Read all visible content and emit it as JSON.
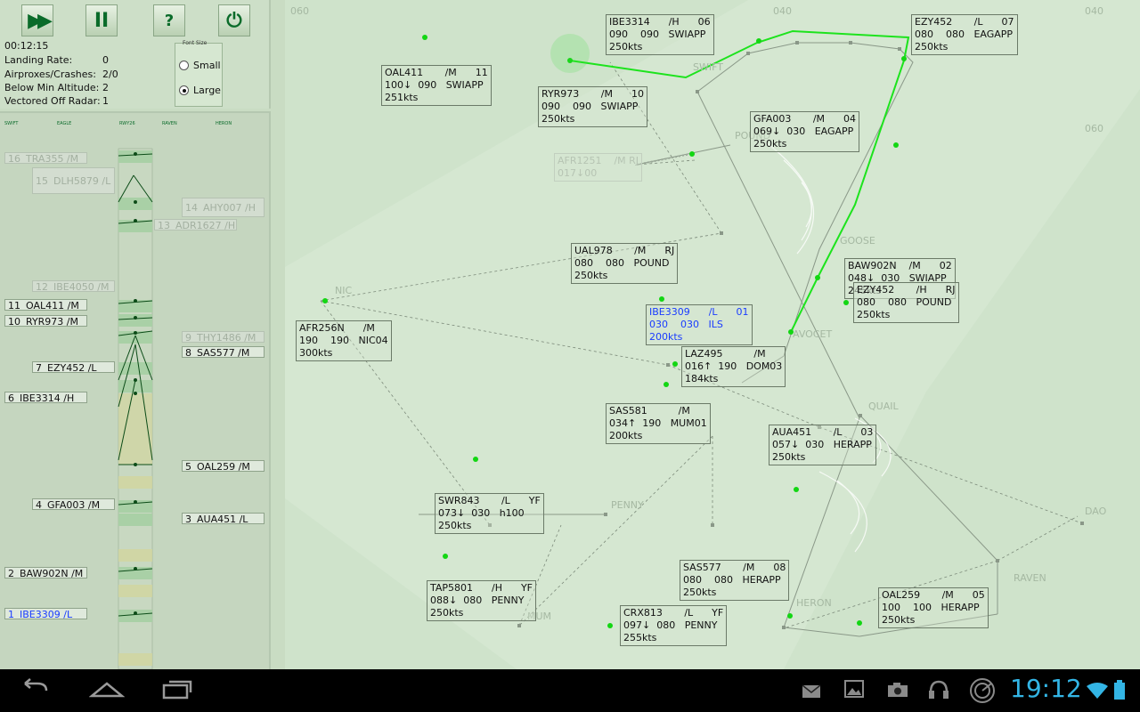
{
  "toolbar": {
    "fast_forward_label": "▶▶",
    "pause_label": "II",
    "help_label": "?",
    "power_label": "⏻"
  },
  "stats": {
    "clock": "00:12:15",
    "landing_rate_label": "Landing Rate:",
    "landing_rate_value": "0",
    "airproxes_label": "Airproxes/Crashes:",
    "airproxes_value": "2/0",
    "below_min_label": "Below Min Altitude:",
    "below_min_value": "2",
    "vectored_off_label": "Vectored Off Radar:",
    "vectored_off_value": "1"
  },
  "font_size": {
    "title": "Font Size",
    "small_label": "Small",
    "large_label": "Large",
    "selected": "Large"
  },
  "strip_columns": [
    "SWIFT",
    "EAGLE",
    "RWY26",
    "RAVEN",
    "HERON"
  ],
  "strips": [
    {
      "num": "16",
      "callsign": "TRA355 /M",
      "state": "dim"
    },
    {
      "num": "15",
      "callsign": "DLH5879 /L",
      "state": "dim"
    },
    {
      "num": "14",
      "callsign": "AHY007 /H",
      "state": "dim"
    },
    {
      "num": "13",
      "callsign": "ADR1627 /H",
      "state": "dim"
    },
    {
      "num": "12",
      "callsign": "IBE4050 /M",
      "state": "dim"
    },
    {
      "num": "11",
      "callsign": "OAL411 /M",
      "state": "normal"
    },
    {
      "num": "10",
      "callsign": "RYR973 /M",
      "state": "normal"
    },
    {
      "num": "9",
      "callsign": "THY1486 /M",
      "state": "dim"
    },
    {
      "num": "8",
      "callsign": "SAS577 /M",
      "state": "normal"
    },
    {
      "num": "7",
      "callsign": "EZY452 /L",
      "state": "normal"
    },
    {
      "num": "6",
      "callsign": "IBE3314 /H",
      "state": "normal"
    },
    {
      "num": "5",
      "callsign": "OAL259 /M",
      "state": "normal"
    },
    {
      "num": "4",
      "callsign": "GFA003 /M",
      "state": "normal"
    },
    {
      "num": "3",
      "callsign": "AUA451 /L",
      "state": "normal"
    },
    {
      "num": "2",
      "callsign": "BAW902N /M",
      "state": "normal"
    },
    {
      "num": "1",
      "callsign": "IBE3309 /L",
      "state": "blue"
    }
  ],
  "waypoints": [
    "SWIFT",
    "POUND",
    "GOOSE",
    "AVOCET",
    "QUAIL",
    "NIC",
    "PENNY",
    "HERON",
    "RAVEN",
    "MUM",
    "DAO",
    "RJ",
    "EAGLE"
  ],
  "headings": [
    "060",
    "040",
    "040",
    "060"
  ],
  "aircraft": [
    {
      "line1": "IBE3314      /H      06",
      "line2": "090    090   SWIAPP",
      "line3": "250kts",
      "state": "normal"
    },
    {
      "line1": "EZY452       /L      07",
      "line2": "080    080   EAGAPP",
      "line3": "250kts",
      "state": "normal"
    },
    {
      "line1": "OAL411       /M      11",
      "line2": "100↓  090   SWIAPP",
      "line3": "251kts",
      "state": "normal"
    },
    {
      "line1": "RYR973       /M      10",
      "line2": "090    090   SWIAPP",
      "line3": "250kts",
      "state": "normal"
    },
    {
      "line1": "GFA003       /M      04",
      "line2": "069↓  030   EAGAPP",
      "line3": "250kts",
      "state": "normal"
    },
    {
      "line1": "AFR1251    /M RJ",
      "line2": "017↓00",
      "line3": "",
      "state": "dim"
    },
    {
      "line1": "UAL978       /M      RJ",
      "line2": "080    080   POUND",
      "line3": "250kts",
      "state": "normal"
    },
    {
      "line1": "BAW902N    /M      02",
      "line2": "048↓  030   SWIAPP",
      "line3": "245kts",
      "state": "normal"
    },
    {
      "line1": "EZY452       /H      RJ",
      "line2": "080    080   POUND",
      "line3": "250kts",
      "state": "normal"
    },
    {
      "line1": "IBE3309      /L      01",
      "line2": "030    030   ILS",
      "line3": "200kts",
      "state": "blue"
    },
    {
      "line1": "AFR256N      /M",
      "line2": "190    190   NIC04",
      "line3": "300kts",
      "state": "normal"
    },
    {
      "line1": "LAZ495          /M",
      "line2": "016↑  190   DOM03",
      "line3": "184kts",
      "state": "normal"
    },
    {
      "line1": "SAS581          /M",
      "line2": "034↑  190   MUM01",
      "line3": "200kts",
      "state": "normal"
    },
    {
      "line1": "AUA451       /L      03",
      "line2": "057↓  030   HERAPP",
      "line3": "250kts",
      "state": "normal"
    },
    {
      "line1": "SWR843       /L      YF",
      "line2": "073↓  030   h100",
      "line3": "250kts",
      "state": "normal"
    },
    {
      "line1": "SAS577       /M      08",
      "line2": "080    080   HERAPP",
      "line3": "250kts",
      "state": "normal"
    },
    {
      "line1": "TAP5801      /H      YF",
      "line2": "088↓  080   PENNY",
      "line3": "250kts",
      "state": "normal"
    },
    {
      "line1": "CRX813       /L      YF",
      "line2": "097↓  080   PENNY",
      "line3": "255kts",
      "state": "normal"
    },
    {
      "line1": "OAL259       /M      05",
      "line2": "100    100   HERAPP",
      "line3": "250kts",
      "state": "normal"
    }
  ],
  "navbar": {
    "back_icon": "back-icon",
    "home_icon": "home-icon",
    "recents_icon": "recents-icon",
    "time": "19:12"
  },
  "colors": {
    "track_green": "#00e000",
    "label_blue": "#1a3cff",
    "clock_blue": "#33b5e5"
  }
}
